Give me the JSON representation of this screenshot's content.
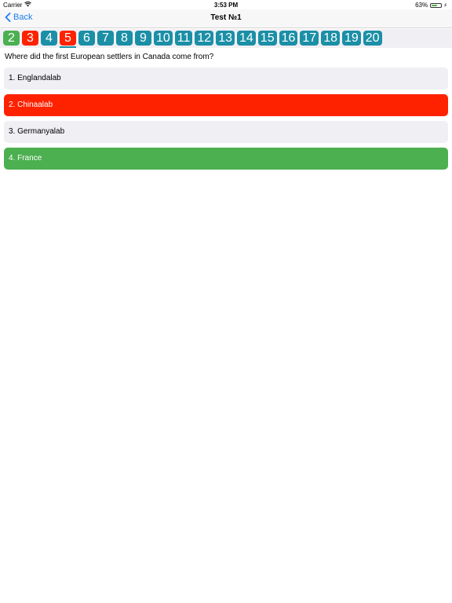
{
  "status_bar": {
    "carrier": "Carrier",
    "time": "3:53 PM",
    "battery": "63%",
    "battery_level": 0.63,
    "icons": [
      "wifi-icon",
      "battery-icon",
      "bolt-icon"
    ]
  },
  "nav": {
    "back_label": "Back",
    "title": "Test №1",
    "accent_color": "#1a7ef5"
  },
  "tabs": [
    {
      "label": "2",
      "state": "correct"
    },
    {
      "label": "3",
      "state": "wrong"
    },
    {
      "label": "4",
      "state": "default"
    },
    {
      "label": "5",
      "state": "wrong",
      "current": true
    },
    {
      "label": "6",
      "state": "default"
    },
    {
      "label": "7",
      "state": "default"
    },
    {
      "label": "8",
      "state": "default"
    },
    {
      "label": "9",
      "state": "default"
    },
    {
      "label": "10",
      "state": "default"
    },
    {
      "label": "11",
      "state": "default"
    },
    {
      "label": "12",
      "state": "default"
    },
    {
      "label": "13",
      "state": "default"
    },
    {
      "label": "14",
      "state": "default"
    },
    {
      "label": "15",
      "state": "default"
    },
    {
      "label": "16",
      "state": "default"
    },
    {
      "label": "17",
      "state": "default"
    },
    {
      "label": "18",
      "state": "default"
    },
    {
      "label": "19",
      "state": "default"
    },
    {
      "label": "20",
      "state": "default"
    }
  ],
  "colors": {
    "tab_default": "#1b8fa6",
    "correct": "#4caf50",
    "wrong": "#ff2200",
    "answer_bg": "#efeff4"
  },
  "question": {
    "text": "Where did the first European settlers in Canada come from?"
  },
  "answers": [
    {
      "label": "1. Englandalab",
      "state": "default"
    },
    {
      "label": "2. Chinaalab",
      "state": "wrong"
    },
    {
      "label": "3. Germanyalab",
      "state": "default"
    },
    {
      "label": "4. France",
      "state": "correct"
    }
  ]
}
